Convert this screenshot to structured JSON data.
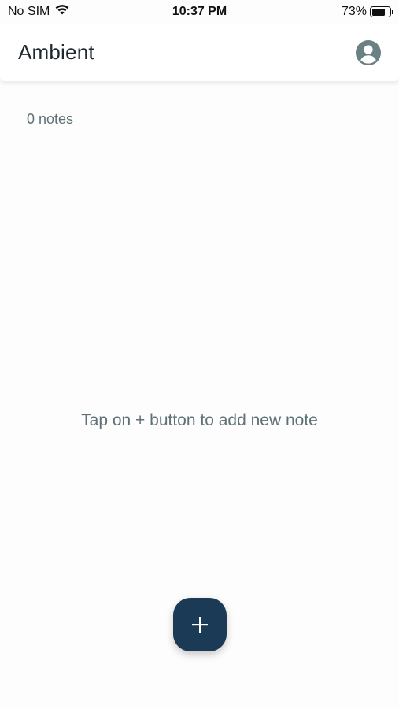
{
  "status_bar": {
    "carrier": "No SIM",
    "time": "10:37 PM",
    "battery_percent": "73%",
    "battery_level": 0.73,
    "wifi_icon": "wifi-icon",
    "battery_icon": "battery-icon"
  },
  "app_bar": {
    "title": "Ambient",
    "profile_icon": "account-circle-icon"
  },
  "main": {
    "notes_count": "0 notes",
    "empty_message": "Tap on + button to add new note"
  },
  "fab": {
    "icon": "plus-icon"
  },
  "colors": {
    "fab_background": "#1b3a55",
    "text_muted": "#5e7275",
    "title_text": "#1f2a30",
    "profile_icon": "#6b8084",
    "background": "#fdfdfd"
  }
}
